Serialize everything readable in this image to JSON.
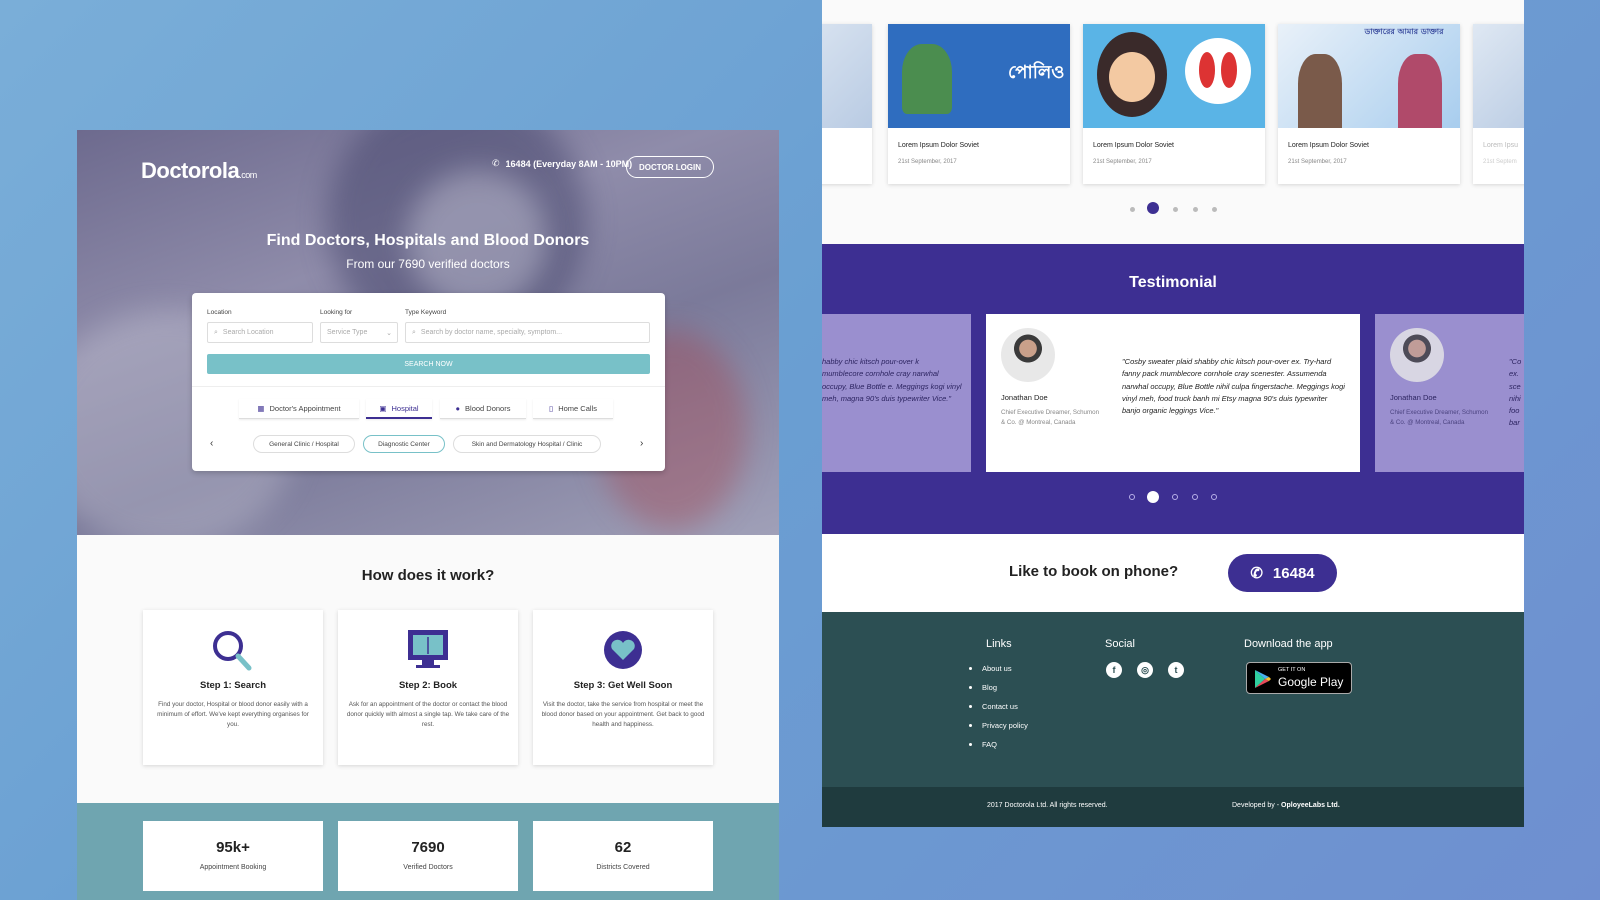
{
  "left": {
    "logo": {
      "name": "Doctorola",
      "suffix": ".com"
    },
    "header": {
      "phone_text": "16484 (Everyday 8AM - 10PM)",
      "login_label": "DOCTOR LOGIN"
    },
    "hero": {
      "title": "Find Doctors, Hospitals and Blood Donors",
      "subtitle": "From our 7690 verified doctors"
    },
    "search": {
      "location_label": "Location",
      "location_placeholder": "Search Location",
      "looking_label": "Looking for",
      "looking_value": "Service Type",
      "keyword_label": "Type Keyword",
      "keyword_placeholder": "Search by doctor name, specialty, symptom...",
      "button_label": "SEARCH NOW"
    },
    "tabs": [
      "Doctor's Appointment",
      "Hospital",
      "Blood Donors",
      "Home Calls"
    ],
    "chips": [
      "General Clinic / Hospital",
      "Diagnostic Center",
      "Skin and Dermatology Hospital / Clinic"
    ],
    "how_title": "How does it work?",
    "steps": [
      {
        "title": "Step 1: Search",
        "text": "Find your doctor, Hospital or blood donor easily with a minimum of effort. We've kept everything organises for you.",
        "icon": "search-icon"
      },
      {
        "title": "Step 2: Book",
        "text": "Ask for an appointment of the doctor or contact the blood donor quickly with almost a single tap. We take care of the rest.",
        "icon": "monitor-book-icon"
      },
      {
        "title": "Step 3: Get Well Soon",
        "text": "Visit the doctor, take the service from hospital or meet the blood donor based on your appointment. Get back to good health and happiness.",
        "icon": "heart-icon"
      }
    ],
    "stats": [
      {
        "value": "95k+",
        "label": "Appointment Booking"
      },
      {
        "value": "7690",
        "label": "Verified Doctors"
      },
      {
        "value": "62",
        "label": "Districts Covered"
      }
    ]
  },
  "right": {
    "blog": [
      {
        "title": "Lorem Ipsum Dolor Soviet",
        "date": "21st September, 2017",
        "art": "পোলিও",
        "color": "#2f6dbf"
      },
      {
        "title": "Lorem Ipsum Dolor Soviet",
        "date": "21st September, 2017",
        "art": "",
        "color": "#5ab4e6"
      },
      {
        "title": "Lorem Ipsum Dolor Soviet",
        "date": "21st September, 2017",
        "art": "ডাক্তারের আমার ডাক্তার",
        "color": "#8fc7ea"
      }
    ],
    "blog_partial_left": {
      "title": "",
      "date": ""
    },
    "blog_partial_right": {
      "title": "Lorem Ipsu",
      "date": "21st Septem"
    },
    "testimonial": {
      "title": "Testimonial",
      "quote": "\"Cosby sweater plaid shabby chic kitsch pour-over ex. Try-hard fanny pack mumblecore cornhole cray scenester. Assumenda narwhal occupy, Blue Bottle nihil culpa fingerstache. Meggings kogi vinyl meh, food truck banh mi Etsy magna 90's duis typewriter banjo organic leggings Vice.\"",
      "left_quote": "habby chic kitsch pour-over k mumblecore cornhole cray narwhal occupy, Blue Bottle e. Meggings kogi vinyl meh, magna 90's duis typewriter Vice.\"",
      "right_quote": "\"Co ex. sce nihi foo bar",
      "name": "Jonathan Doe",
      "role": "Chief Executive Dreamer, Schumon & Co. @ Montreal, Canada"
    },
    "book": {
      "text": "Like to book on phone?",
      "number": "16484"
    },
    "footer": {
      "links_title": "Links",
      "links": [
        "About us",
        "Blog",
        "Contact us",
        "Privacy policy",
        "FAQ"
      ],
      "social_title": "Social",
      "social": [
        "facebook-icon",
        "instagram-icon",
        "twitter-icon"
      ],
      "app_title": "Download the app",
      "gp_top": "GET IT ON",
      "gp_bottom": "Google Play",
      "copyright": "2017 Doctorola Ltd. All rights reserved.",
      "developed_prefix": "Developed by - ",
      "developed_by": "OployeeLabs Ltd."
    }
  },
  "colors": {
    "primary": "#3d2f92",
    "teal": "#78c1c8",
    "footer": "#2c4f53"
  }
}
